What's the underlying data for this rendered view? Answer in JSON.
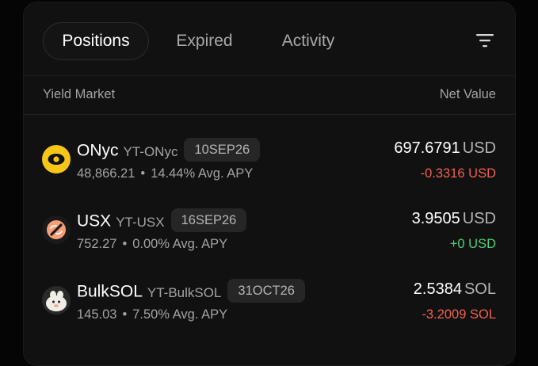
{
  "tabs": [
    {
      "label": "Positions",
      "active": true
    },
    {
      "label": "Expired",
      "active": false
    },
    {
      "label": "Activity",
      "active": false
    }
  ],
  "filter": {
    "icon": "filter-icon"
  },
  "table": {
    "col_market": "Yield Market",
    "col_value": "Net Value"
  },
  "positions": [
    {
      "name": "ONyc",
      "ticker": "YT-ONyc",
      "maturity": "10SEP26",
      "amount": "48,866.21",
      "apy": "14.44% Avg. APY",
      "value": "697.6791",
      "unit": "USD",
      "change": "-0.3316 USD",
      "change_color": "#f0614e",
      "icon": "onyc-logo-icon"
    },
    {
      "name": "USX",
      "ticker": "YT-USX",
      "maturity": "16SEP26",
      "amount": "752.27",
      "apy": "0.00% Avg. APY",
      "value": "3.9505",
      "unit": "USD",
      "change": "+0 USD",
      "change_color": "#4ed17a",
      "icon": "usx-logo-icon"
    },
    {
      "name": "BulkSOL",
      "ticker": "YT-BulkSOL",
      "maturity": "31OCT26",
      "amount": "145.03",
      "apy": "7.50% Avg. APY",
      "value": "2.5384",
      "unit": "SOL",
      "change": "-3.2009 SOL",
      "change_color": "#f0614e",
      "icon": "bulksol-logo-icon"
    }
  ],
  "separator": "•"
}
